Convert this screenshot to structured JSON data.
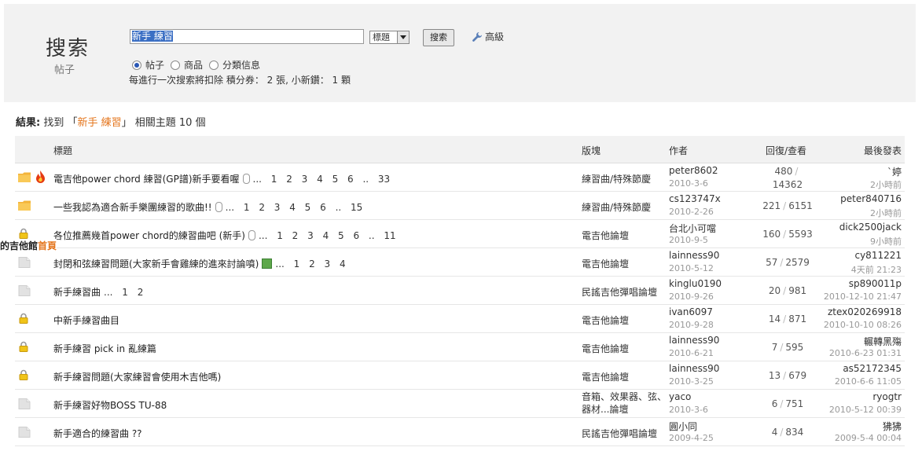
{
  "header": {
    "title": "搜索",
    "subtitle": "帖子",
    "search_value": "新手 練習",
    "scope_selected": "標題",
    "search_button": "搜索",
    "advanced_label": "高級",
    "radio_options": [
      "帖子",
      "商品",
      "分類信息"
    ],
    "radio_selected_index": 0,
    "note": "每進行一次搜索將扣除 積分券： 2 張, 小新鑽： 1 顆"
  },
  "result": {
    "label": "結果:",
    "pre": "找到 「",
    "keyword": "新手 練習",
    "post": "」 相關主題 10 個"
  },
  "columns": {
    "title": "標題",
    "forum": "版塊",
    "author": "作者",
    "replies_views": "回復/查看",
    "last_post": "最後發表"
  },
  "overlay": {
    "text": "的吉他館",
    "link": "首頁"
  },
  "rows": [
    {
      "icon": "folder-hot",
      "fire": true,
      "title": "電吉他power chord 練習(GP譜)新手要看喔",
      "attach": "clip",
      "pages": "... 1 2 3 4 5 6 .. 33",
      "forum": "練習曲/特殊節慶",
      "author": "peter8602",
      "date": "2010-3-6",
      "replies": "480",
      "views": "14362",
      "last_author": "`婷",
      "last_date": "2小時前"
    },
    {
      "icon": "folder",
      "fire": false,
      "title": "一些我認為適合新手樂團練習的歌曲!!",
      "attach": "clip",
      "pages": "... 1 2 3 4 5 6 .. 15",
      "forum": "練習曲/特殊節慶",
      "author": "cs123747x",
      "date": "2010-2-26",
      "replies": "221",
      "views": "6151",
      "last_author": "peter840716",
      "last_date": "2小時前"
    },
    {
      "icon": "lock",
      "fire": false,
      "title": "各位推薦幾首power chord的練習曲吧 (新手)",
      "attach": "clip",
      "pages": "... 1 2 3 4 5 6 .. 11",
      "forum": "電吉他論壇",
      "author": "台北小可噹",
      "date": "2010-9-5",
      "replies": "160",
      "views": "5593",
      "last_author": "dick2500jack",
      "last_date": "9小時前"
    },
    {
      "icon": "page",
      "fire": false,
      "title": "封閉和弦練習問題(大家新手會雞練的進來討論噴)",
      "attach": "image",
      "pages": "... 1 2 3 4",
      "forum": "電吉他論壇",
      "author": "lainness90",
      "date": "2010-5-12",
      "replies": "57",
      "views": "2579",
      "last_author": "cy811221",
      "last_date": "4天前 21:23"
    },
    {
      "icon": "page",
      "fire": false,
      "title": "新手練習曲",
      "attach": "",
      "pages": "... 1 2",
      "forum": "民謠吉他彈唱論壇",
      "author": "kinglu0190",
      "date": "2010-9-26",
      "replies": "20",
      "views": "981",
      "last_author": "sp890011p",
      "last_date": "2010-12-10 21:47"
    },
    {
      "icon": "lock",
      "fire": false,
      "title": "中新手練習曲目",
      "attach": "",
      "pages": "",
      "forum": "電吉他論壇",
      "author": "ivan6097",
      "date": "2010-9-28",
      "replies": "14",
      "views": "871",
      "last_author": "ztex020269918",
      "last_date": "2010-10-10 08:26"
    },
    {
      "icon": "lock",
      "fire": false,
      "title": "新手練習 pick in 亂練篇",
      "attach": "",
      "pages": "",
      "forum": "電吉他論壇",
      "author": "lainness90",
      "date": "2010-6-21",
      "replies": "7",
      "views": "595",
      "last_author": "輾轉黑殤",
      "last_date": "2010-6-23 01:31"
    },
    {
      "icon": "lock",
      "fire": false,
      "title": "新手練習問題(大家練習會使用木吉他嗎)",
      "attach": "",
      "pages": "",
      "forum": "電吉他論壇",
      "author": "lainness90",
      "date": "2010-3-25",
      "replies": "13",
      "views": "679",
      "last_author": "as52172345",
      "last_date": "2010-6-6 11:05"
    },
    {
      "icon": "page",
      "fire": false,
      "title": "新手練習好物BOSS TU-88",
      "attach": "",
      "pages": "",
      "forum": "音箱、效果器、弦、器材...論壇",
      "author": "yaco",
      "date": "2010-3-6",
      "replies": "6",
      "views": "751",
      "last_author": "ryogtr",
      "last_date": "2010-5-12 00:39"
    },
    {
      "icon": "page",
      "fire": false,
      "title": "新手適合的練習曲 ??",
      "attach": "",
      "pages": "",
      "forum": "民謠吉他彈唱論壇",
      "author": "圓小同",
      "date": "2009-4-25",
      "replies": "4",
      "views": "834",
      "last_author": "狒狒",
      "last_date": "2009-5-4 00:04"
    }
  ]
}
